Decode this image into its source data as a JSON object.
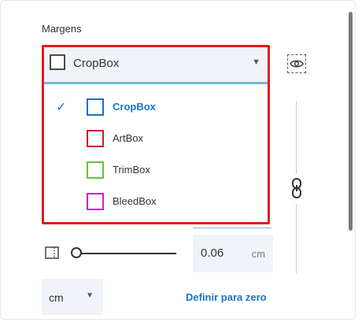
{
  "section": {
    "title": "Margens"
  },
  "margin_select": {
    "value": "CropBox",
    "chevron_icon": "chevron-down-icon"
  },
  "eye_button": {
    "icon": "eye-icon"
  },
  "dropdown": {
    "items": [
      {
        "label": "CropBox",
        "color": "#1f6fd0",
        "selected": true
      },
      {
        "label": "ArtBox",
        "color": "#d01d2a",
        "selected": false
      },
      {
        "label": "TrimBox",
        "color": "#67c23a",
        "selected": false
      },
      {
        "label": "BleedBox",
        "color": "#d11fd0",
        "selected": false
      }
    ],
    "selected_icon": "checkmark-icon"
  },
  "link_icon": {
    "icon": "chain-link-icon"
  },
  "offset": {
    "value": "0.06",
    "unit": "cm",
    "ruler_icon": "ruler-icon"
  },
  "unit_select": {
    "value": "cm"
  },
  "reset_link": {
    "label": "Definir para zero"
  },
  "colors": {
    "accent": "#1a73c9",
    "highlight": "#e21b1b",
    "field_bg": "#f0f4f9",
    "focus_underline": "#74b6df"
  }
}
